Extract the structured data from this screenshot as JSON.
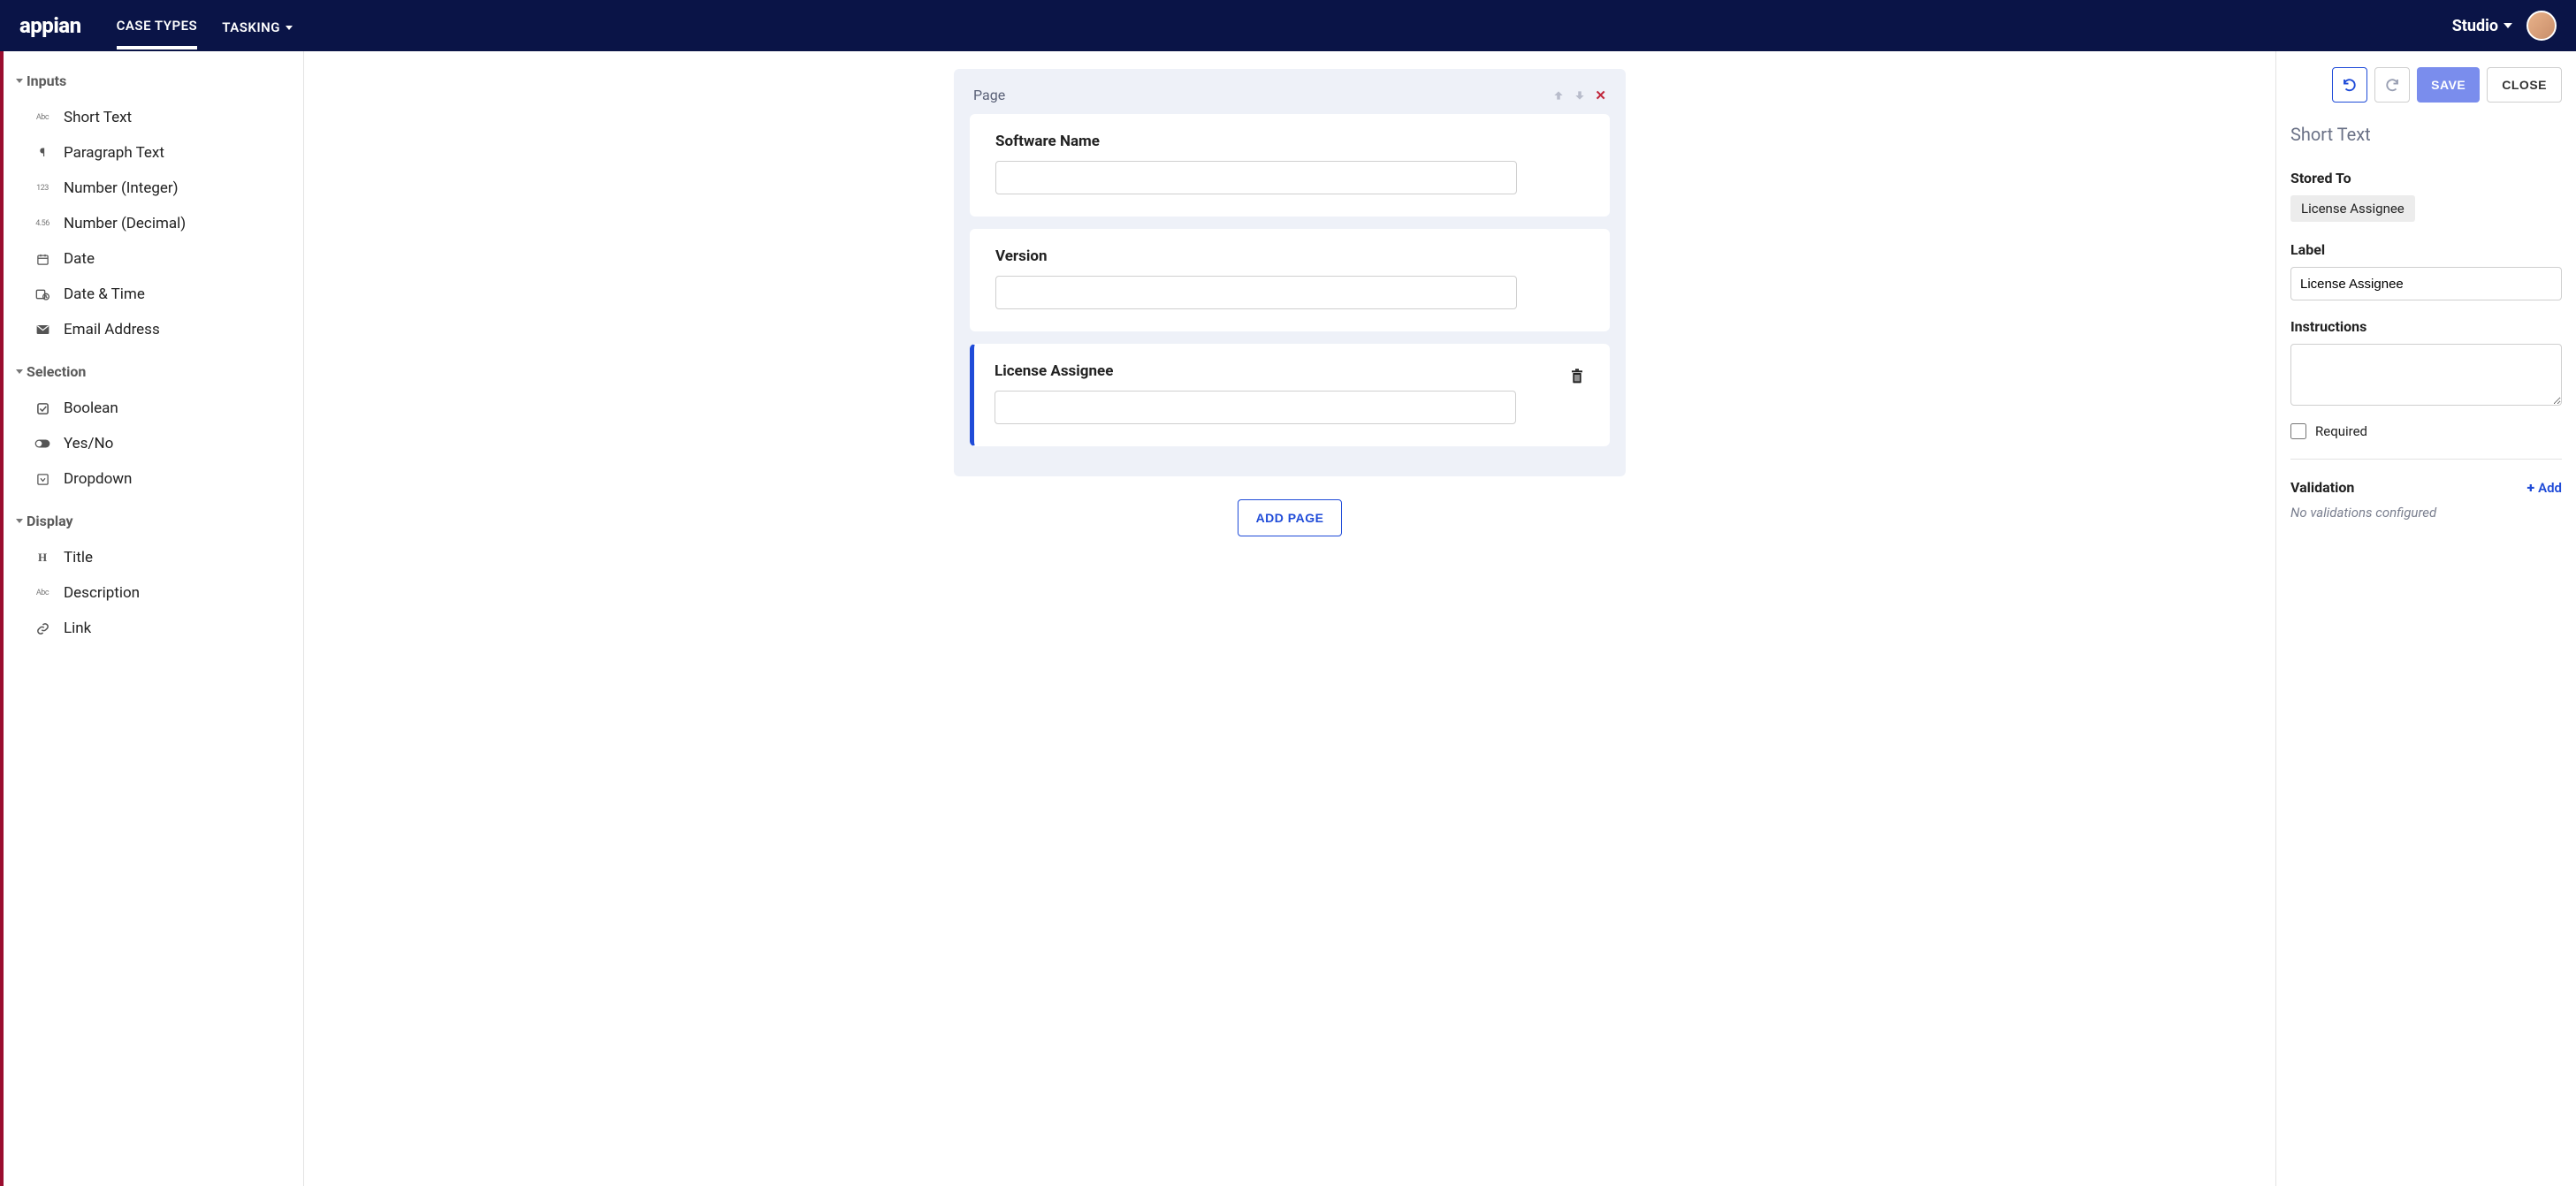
{
  "topbar": {
    "logo": "appian",
    "nav": [
      {
        "label": "CASE TYPES",
        "active": true
      },
      {
        "label": "TASKING",
        "active": false
      }
    ],
    "workspace": "Studio"
  },
  "sidebar": {
    "sections": [
      {
        "title": "Inputs",
        "items": [
          {
            "icon": "abc",
            "label": "Short Text"
          },
          {
            "icon": "paragraph",
            "label": "Paragraph Text"
          },
          {
            "icon": "123",
            "label": "Number (Integer)"
          },
          {
            "icon": "456",
            "label": "Number (Decimal)"
          },
          {
            "icon": "calendar",
            "label": "Date"
          },
          {
            "icon": "datetime",
            "label": "Date & Time"
          },
          {
            "icon": "envelope",
            "label": "Email Address"
          }
        ]
      },
      {
        "title": "Selection",
        "items": [
          {
            "icon": "checkbox",
            "label": "Boolean"
          },
          {
            "icon": "toggle",
            "label": "Yes/No"
          },
          {
            "icon": "dropdown",
            "label": "Dropdown"
          }
        ]
      },
      {
        "title": "Display",
        "items": [
          {
            "icon": "H",
            "label": "Title"
          },
          {
            "icon": "abc",
            "label": "Description"
          },
          {
            "icon": "link",
            "label": "Link"
          }
        ]
      }
    ]
  },
  "canvas": {
    "page_label": "Page",
    "fields": [
      {
        "label": "Software Name",
        "selected": false
      },
      {
        "label": "Version",
        "selected": false
      },
      {
        "label": "License Assignee",
        "selected": true
      }
    ],
    "add_page": "ADD PAGE"
  },
  "props": {
    "actions": {
      "save": "SAVE",
      "close": "CLOSE"
    },
    "type_title": "Short Text",
    "stored_to_label": "Stored To",
    "stored_to_value": "License Assignee",
    "label_label": "Label",
    "label_value": "License Assignee",
    "instructions_label": "Instructions",
    "instructions_value": "",
    "required_label": "Required",
    "required_checked": false,
    "validation_label": "Validation",
    "add_label": "Add",
    "no_validation": "No validations configured"
  }
}
